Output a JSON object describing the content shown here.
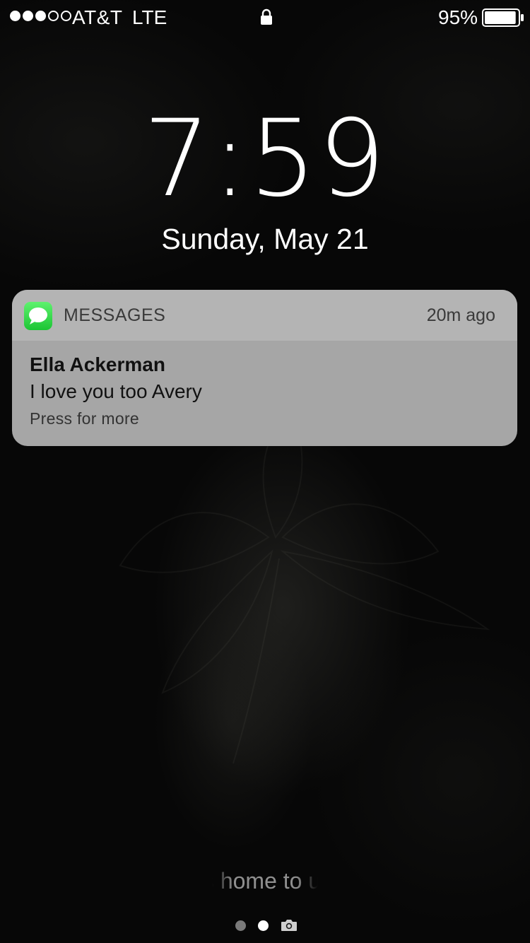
{
  "status_bar": {
    "signal_bars_filled": 3,
    "signal_bars_total": 5,
    "carrier": "AT&T",
    "network": "LTE",
    "lock_icon": "lock-icon",
    "battery_percent": "95%",
    "battery_level": 0.95
  },
  "lock_screen": {
    "time": "7:59",
    "date": "Sunday, May 21"
  },
  "notification": {
    "app_icon": "messages-icon",
    "app_name": "MESSAGES",
    "time_ago": "20m ago",
    "sender": "Ella Ackerman",
    "message": "I love you too Avery",
    "hint": "Press for more"
  },
  "bottom": {
    "unlock_hint": "Press home to unlock",
    "pages": [
      "page-dot",
      "page-dot-active",
      "camera-icon"
    ]
  },
  "colors": {
    "messages_green": "#34c759",
    "notification_header": "#b4b4b4",
    "notification_body": "#a6a6a6"
  }
}
